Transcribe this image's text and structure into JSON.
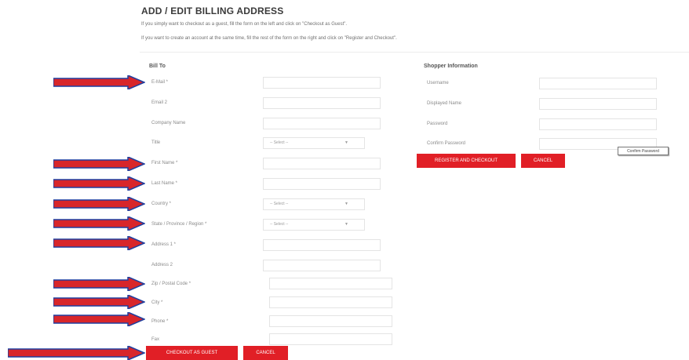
{
  "page": {
    "title": "ADD / EDIT BILLING ADDRESS",
    "intro_guest": "If you simply want to checkout as a guest, fill the form on the left and click on \"Checkout as Guest\".",
    "intro_register": "If you want to create an account at the same time, fill the rest of the form on the right and click on \"Register and Checkout\"."
  },
  "bill_to": {
    "heading": "Bill To",
    "fields": [
      {
        "label": "E-Mail *",
        "type": "text",
        "value": ""
      },
      {
        "label": "Email 2",
        "type": "text",
        "value": ""
      },
      {
        "label": "Company Name",
        "type": "text",
        "value": ""
      },
      {
        "label": "Title",
        "type": "select",
        "value": "-- Select --"
      },
      {
        "label": "First Name *",
        "type": "text",
        "value": ""
      },
      {
        "label": "Last Name *",
        "type": "text",
        "value": ""
      },
      {
        "label": "Country *",
        "type": "select",
        "value": "-- Select --"
      },
      {
        "label": "State / Province / Region *",
        "type": "select",
        "value": "-- Select --"
      },
      {
        "label": "Address 1 *",
        "type": "text",
        "value": ""
      },
      {
        "label": "Address 2",
        "type": "text",
        "value": ""
      },
      {
        "label": "Zip / Postal Code *",
        "type": "text",
        "value": ""
      },
      {
        "label": "City *",
        "type": "text",
        "value": ""
      },
      {
        "label": "Phone *",
        "type": "text",
        "value": ""
      },
      {
        "label": "Fax",
        "type": "text",
        "value": ""
      }
    ],
    "checkout_guest_label": "CHECKOUT AS GUEST",
    "cancel_label": "CANCEL"
  },
  "shopper": {
    "heading": "Shopper Information",
    "fields": [
      {
        "label": "Username",
        "value": ""
      },
      {
        "label": "Displayed Name",
        "value": ""
      },
      {
        "label": "Password",
        "value": ""
      },
      {
        "label": "Confirm Password",
        "value": ""
      }
    ],
    "register_label": "REGISTER AND CHECKOUT",
    "cancel_label": "CANCEL",
    "tooltip": "Confirm Password"
  },
  "colors": {
    "accent": "#e11f26",
    "annotation_arrow_fill": "#d8262a",
    "annotation_arrow_outline": "#1f3fa0"
  },
  "icons": {
    "select_caret": "chevron-down-icon",
    "annotation": "red-arrow-icon"
  }
}
